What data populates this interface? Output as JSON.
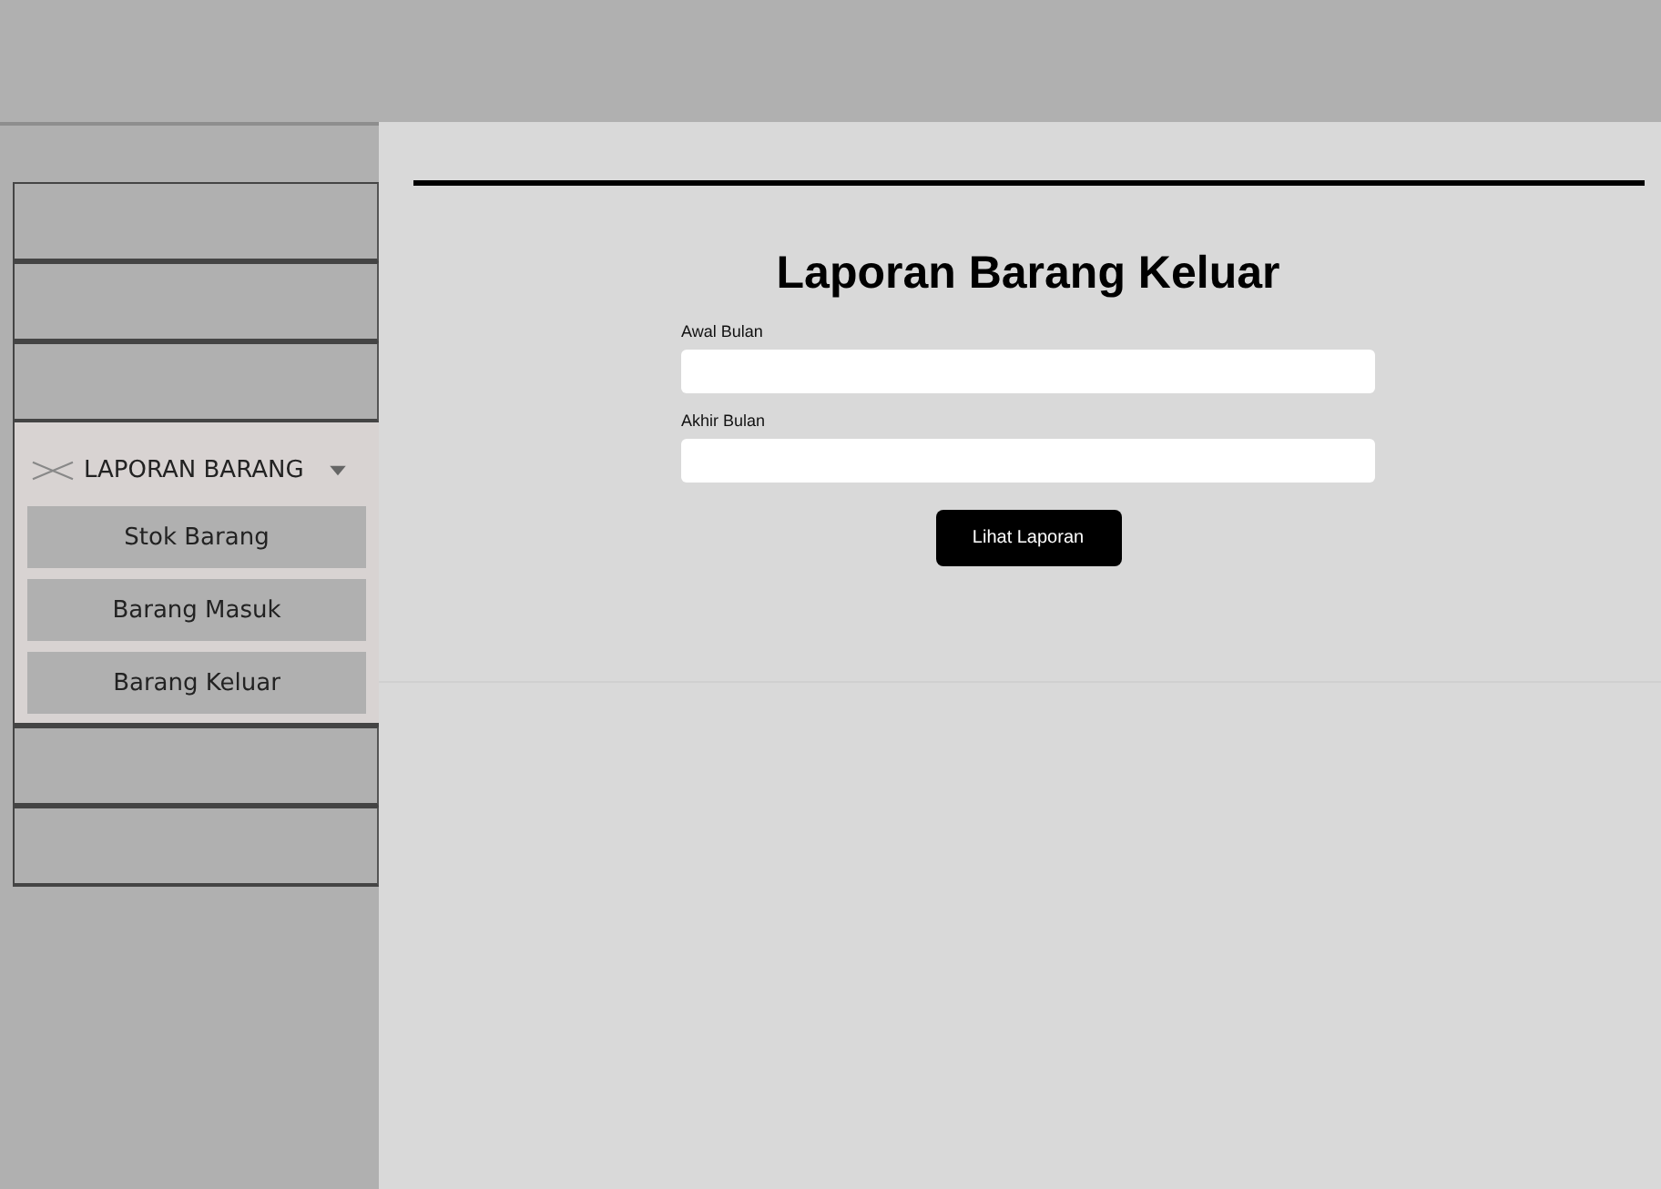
{
  "sidebar": {
    "items": [
      {
        "kind": "blank"
      },
      {
        "kind": "blank"
      },
      {
        "kind": "blank"
      },
      {
        "kind": "group",
        "label": "LAPORAN BARANG",
        "expanded": true,
        "children": [
          {
            "label": "Stok Barang"
          },
          {
            "label": "Barang Masuk"
          },
          {
            "label": "Barang Keluar"
          }
        ]
      },
      {
        "kind": "blank"
      },
      {
        "kind": "blank"
      }
    ]
  },
  "form": {
    "title": "Laporan Barang Keluar",
    "fields": [
      {
        "label": "Awal Bulan"
      },
      {
        "label": "Akhir Bulan"
      }
    ],
    "button": "Lihat Laporan"
  }
}
